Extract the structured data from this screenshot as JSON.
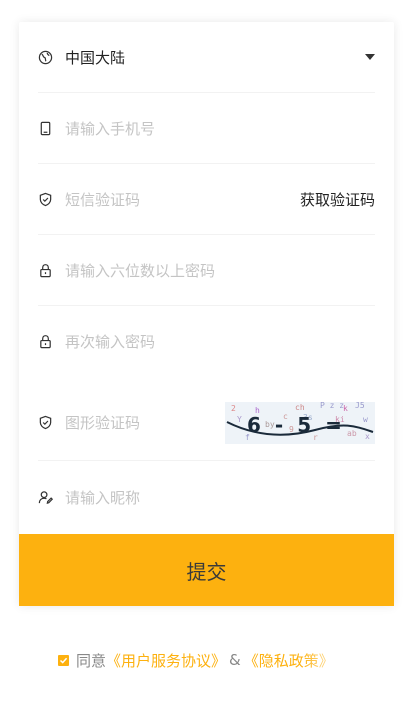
{
  "region": {
    "label": "中国大陆"
  },
  "phone": {
    "placeholder": "请输入手机号"
  },
  "sms": {
    "placeholder": "短信验证码",
    "get_code": "获取验证码"
  },
  "password": {
    "placeholder": "请输入六位数以上密码"
  },
  "password_confirm": {
    "placeholder": "再次输入密码"
  },
  "captcha": {
    "placeholder": "图形验证码",
    "image_text": "6-5="
  },
  "nickname": {
    "placeholder": "请输入昵称"
  },
  "submit_label": "提交",
  "agreement": {
    "prefix": "同意",
    "user_agreement": "《用户服务协议》",
    "amp": "&",
    "privacy": "《隐私政策》"
  },
  "colors": {
    "accent": "#fdb10f"
  },
  "icons": {
    "region": "globe-icon",
    "phone": "phone-icon",
    "sms": "shield-check-icon",
    "password": "lock-icon",
    "nickname": "user-edit-icon"
  }
}
